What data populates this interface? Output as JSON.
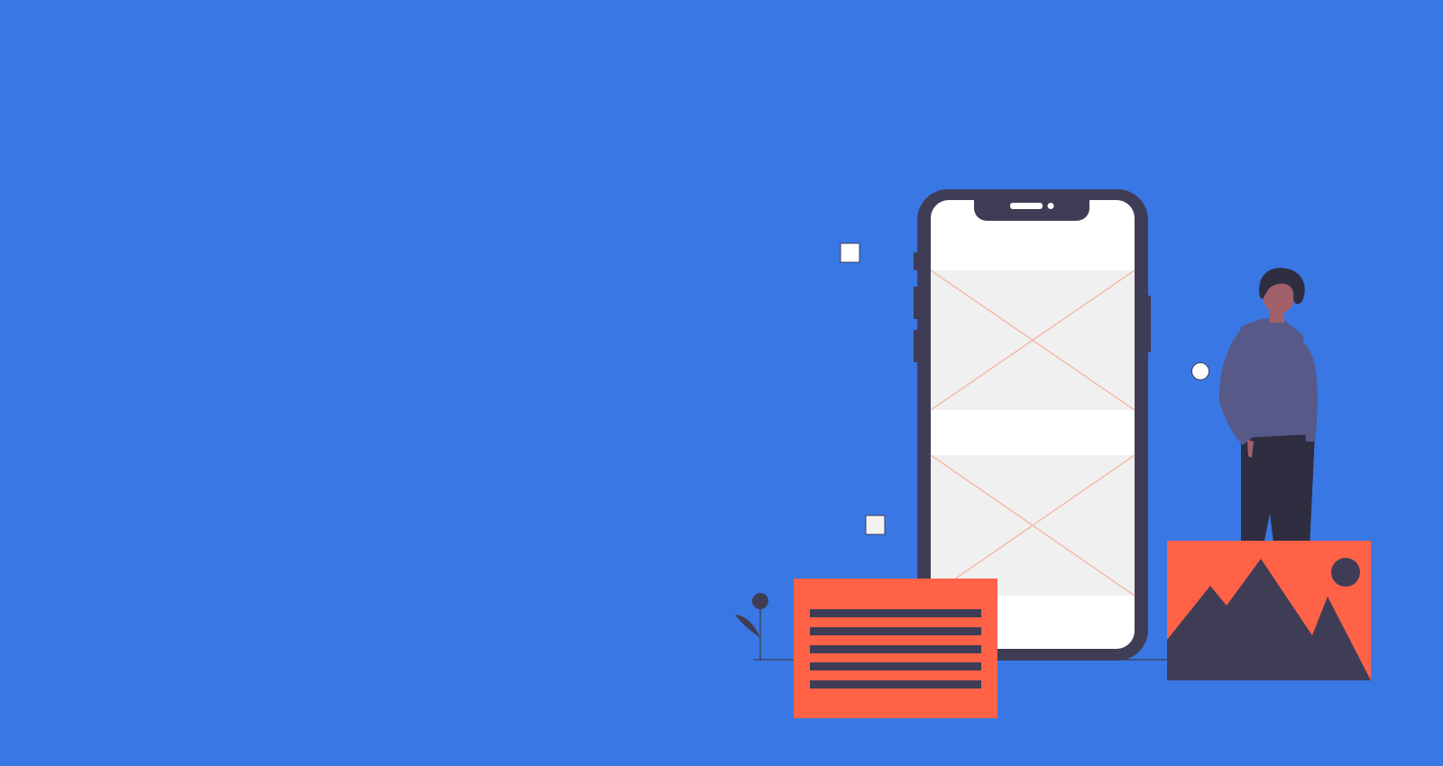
{
  "colors": {
    "background": "#3978e4",
    "device_frame": "#3f3d56",
    "screen": "#ffffff",
    "placeholder_fill": "#f0f0f0",
    "placeholder_cross": "#f5b3a0",
    "accent_card": "#ff6247",
    "card_lines": "#3f3d56",
    "person_shirt": "#575a89",
    "person_skin": "#a0616a",
    "person_hair": "#2f2e41",
    "person_pants": "#2f2e41",
    "deco_square": "#ffffff",
    "deco_circle": "#ffffff"
  },
  "icons": {
    "phone": "smartphone-wireframe-icon",
    "text_card": "text-lines-card-icon",
    "image_card": "image-mountains-card-icon",
    "plant": "plant-icon",
    "person": "person-illustration"
  }
}
